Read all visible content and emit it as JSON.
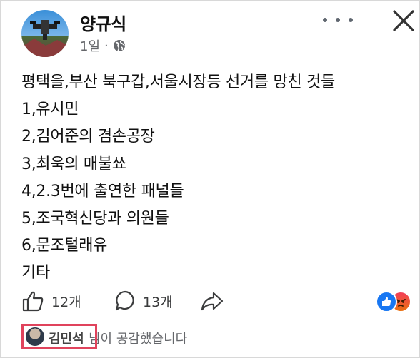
{
  "post": {
    "author": "양규식",
    "time": "1일",
    "separator": "·",
    "lines": [
      "평택을,부산 북구갑,서울시장등 선거를 망친 것들",
      "1,유시민",
      "2,김어준의 겸손공장",
      "3,최욱의 매불쑈",
      "4,2.3번에 출연한 패널들",
      "5,조국혁신당과 의원들",
      "6,문조털래유",
      "기타"
    ]
  },
  "actions": {
    "likes": "12개",
    "comments": "13개"
  },
  "reaction_footer": {
    "name": "김민석",
    "suffix": "님이 공감했습니다"
  },
  "icons": {
    "more": "more-dots-icon",
    "close": "close-icon",
    "privacy": "globe-icon",
    "like": "thumbs-up-icon",
    "comment": "comment-bubble-icon",
    "share": "share-arrow-icon"
  },
  "colors": {
    "like_blue": "#1877f2",
    "highlight_red": "#e0435c",
    "meta_gray": "#65676b"
  }
}
